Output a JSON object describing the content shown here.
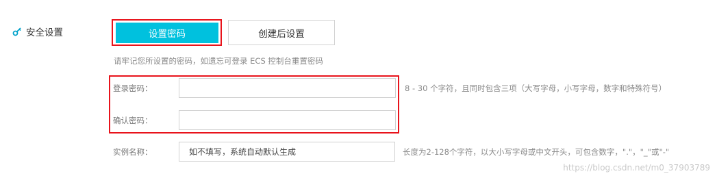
{
  "section": {
    "title": "安全设置",
    "icon": "key-icon"
  },
  "tabs": [
    {
      "label": "设置密码",
      "active": true
    },
    {
      "label": "创建后设置",
      "active": false
    }
  ],
  "hint": "请牢记您所设置的密码，如遗忘可登录 ECS 控制台重置密码",
  "form": {
    "login_password": {
      "label": "登录密码：",
      "value": "",
      "rule": "8 - 30 个字符，且同时包含三项（大写字母，小写字母，数字和特殊符号）"
    },
    "confirm_password": {
      "label": "确认密码：",
      "value": ""
    },
    "instance_name": {
      "label": "实例名称：",
      "placeholder": "如不填写，系统自动默认生成",
      "rule": "长度为2-128个字符，以大小写字母或中文开头，可包含数字，\".\"，\"_\"或\"-\""
    }
  },
  "watermark": "https://blog.csdn.net/m0_37903789",
  "colors": {
    "accent": "#00c1de",
    "highlight": "#e8131b",
    "icon": "#00a2ca"
  }
}
